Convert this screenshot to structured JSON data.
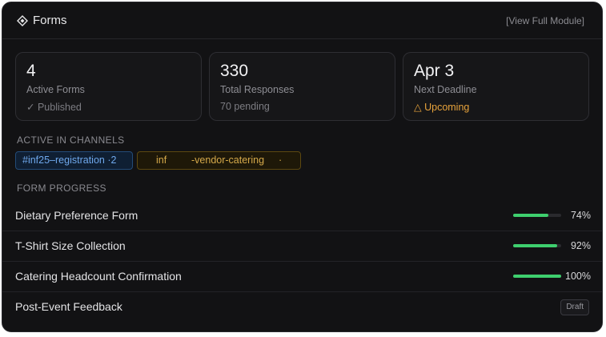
{
  "header": {
    "title": "Forms",
    "link": "[View Full Module]"
  },
  "stats": [
    {
      "value": "4",
      "label": "Active Forms",
      "sub": "✓ Published"
    },
    {
      "value": "330",
      "label": "Total Responses",
      "sub": "70 pending"
    },
    {
      "value": "Apr 3",
      "label": "Next Deadline",
      "sub": "△ Upcoming"
    }
  ],
  "channels": {
    "heading": "ACTIVE IN CHANNELS",
    "items": [
      {
        "text": "#inf25–registration ·2"
      },
      {
        "part1": "inf",
        "part2": "-vendor-catering",
        "part3": "·"
      }
    ]
  },
  "progress": {
    "heading": "FORM PROGRESS",
    "forms": [
      {
        "name": "Dietary Preference Form",
        "percent": "74%",
        "value": 74
      },
      {
        "name": "T-Shirt Size Collection",
        "percent": "92%",
        "value": 92
      },
      {
        "name": "Catering Headcount Confirmation",
        "percent": "100%",
        "value": 100
      },
      {
        "name": "Post-Event Feedback",
        "status": "Draft"
      }
    ]
  },
  "colors": {
    "accent_green": "#3ecf6e",
    "warn_amber": "#e8a33b",
    "chip_blue": "#6fa8ec"
  }
}
